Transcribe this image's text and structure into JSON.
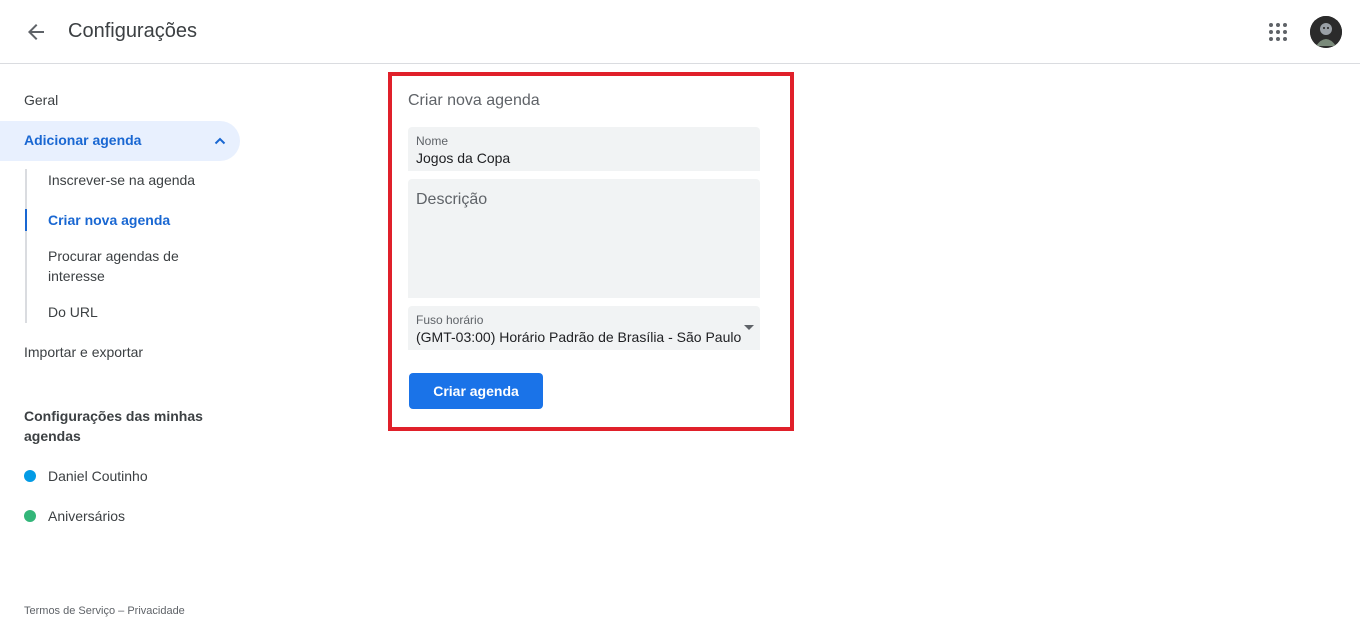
{
  "header": {
    "title": "Configurações",
    "back_icon": "arrow-left-icon",
    "apps_icon": "apps-grid-icon"
  },
  "sidebar": {
    "general": "Geral",
    "add_calendar": "Adicionar agenda",
    "sub_items": [
      "Inscrever-se na agenda",
      "Criar nova agenda",
      "Procurar agendas de interesse",
      "Do URL"
    ],
    "import_export": "Importar e exportar",
    "my_calendars_title": "Configurações das minhas agendas",
    "calendars": [
      {
        "name": "Daniel Coutinho",
        "color": "#039be5"
      },
      {
        "name": "Aniversários",
        "color": "#33b679"
      }
    ],
    "footer": {
      "terms": "Termos de Serviço",
      "separator": " – ",
      "privacy": "Privacidade"
    }
  },
  "form": {
    "title": "Criar nova agenda",
    "name_label": "Nome",
    "name_value": "Jogos da Copa",
    "description_placeholder": "Descrição",
    "timezone_label": "Fuso horário",
    "timezone_value": "(GMT-03:00) Horário Padrão de Brasília - São Paulo",
    "create_button": "Criar agenda"
  },
  "colors": {
    "accent": "#1a73e8",
    "active_text": "#1967d2",
    "active_bg": "#e8f0fe",
    "highlight": "#e0202a"
  }
}
